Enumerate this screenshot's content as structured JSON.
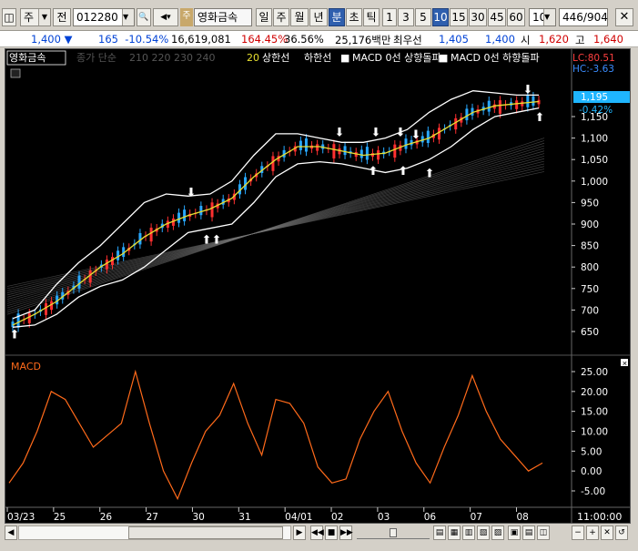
{
  "toolbar": {
    "market": "주",
    "market_btn": "전",
    "code": "012280",
    "stock_badge": "주",
    "stock_name": "영화금속",
    "periods": [
      "일",
      "주",
      "월",
      "년",
      "분",
      "초",
      "틱"
    ],
    "intervals": [
      "1",
      "3",
      "5",
      "10",
      "15",
      "30",
      "45",
      "60"
    ],
    "count": "10",
    "page": "446",
    "page_total": "/904"
  },
  "quote": {
    "price": "1,400",
    "change": "165",
    "change_pct": "-10.54%",
    "volume": "16,619,081",
    "vol_ratio": "164.45%",
    "turnover": "36.56%",
    "amount": "25,176백만",
    "best_ask_label": "최우선",
    "best_ask": "1,405",
    "best_bid": "1,400",
    "open_label": "시",
    "open": "1,620",
    "high_label": "고",
    "high": "1,640"
  },
  "legend": {
    "stock": "영화금속",
    "ma_label": "종가 단순",
    "ma_periods": "210  220  230  240",
    "ma20": "20",
    "upper": "상한선",
    "lower": "하한선",
    "sig_up": "MACD 0선 상향돌파",
    "sig_down": "MACD 0선 하향돌파",
    "lc": "LC:80.51",
    "hc": "HC:-3.63",
    "price_tag": "1,195",
    "price_tag_pct": "-0.42%"
  },
  "macd_label": "MACD",
  "time_end": "11:00:00",
  "colors": {
    "up": "#d00000",
    "down": "#0042d6",
    "macd": "#ff6a1a",
    "ma20": "#e8e030",
    "band": "#ffffff",
    "tag": "#1fb6ff"
  },
  "chart_data": [
    {
      "type": "line",
      "title": "영화금속",
      "y_ticks": [
        "1,150",
        "1,100",
        "1,050",
        "1,000",
        "950",
        "900",
        "850",
        "800",
        "750",
        "700",
        "650"
      ],
      "x_labels": [
        "03/23",
        "25",
        "26",
        "27",
        "30",
        "31",
        "04/01",
        "02",
        "03",
        "06",
        "07",
        "08"
      ],
      "series": [
        {
          "name": "20",
          "values": [
            665,
            690,
            720,
            760,
            800,
            830,
            870,
            900,
            920,
            935,
            960,
            1010,
            1050,
            1080,
            1080,
            1070,
            1060,
            1065,
            1085,
            1100,
            1130,
            1160,
            1175,
            1180,
            1185
          ]
        },
        {
          "name": "상한선",
          "values": [
            680,
            700,
            760,
            810,
            850,
            900,
            950,
            970,
            965,
            970,
            1000,
            1060,
            1110,
            1110,
            1100,
            1090,
            1090,
            1100,
            1120,
            1160,
            1190,
            1210,
            1205,
            1200,
            1200
          ]
        },
        {
          "name": "하한선",
          "values": [
            660,
            665,
            690,
            730,
            755,
            770,
            800,
            840,
            880,
            890,
            900,
            950,
            1010,
            1040,
            1045,
            1040,
            1030,
            1020,
            1030,
            1050,
            1080,
            1120,
            1150,
            1160,
            1170
          ]
        }
      ],
      "ylim": [
        620,
        1230
      ]
    },
    {
      "type": "line",
      "title": "MACD",
      "y_ticks": [
        "25.00",
        "20.00",
        "15.00",
        "10.00",
        "5.00",
        "0.00",
        "-5.00"
      ],
      "series": [
        {
          "name": "MACD",
          "values": [
            -3,
            2,
            10,
            20,
            18,
            12,
            6,
            9,
            12,
            25,
            12,
            0,
            -7,
            2,
            10,
            14,
            22,
            12,
            4,
            18,
            17,
            12,
            1,
            -3,
            -2,
            8,
            15,
            20,
            10,
            2,
            -3,
            6,
            14,
            24,
            15,
            8,
            4,
            0,
            2
          ]
        }
      ],
      "ylim": [
        -8,
        28
      ]
    }
  ]
}
